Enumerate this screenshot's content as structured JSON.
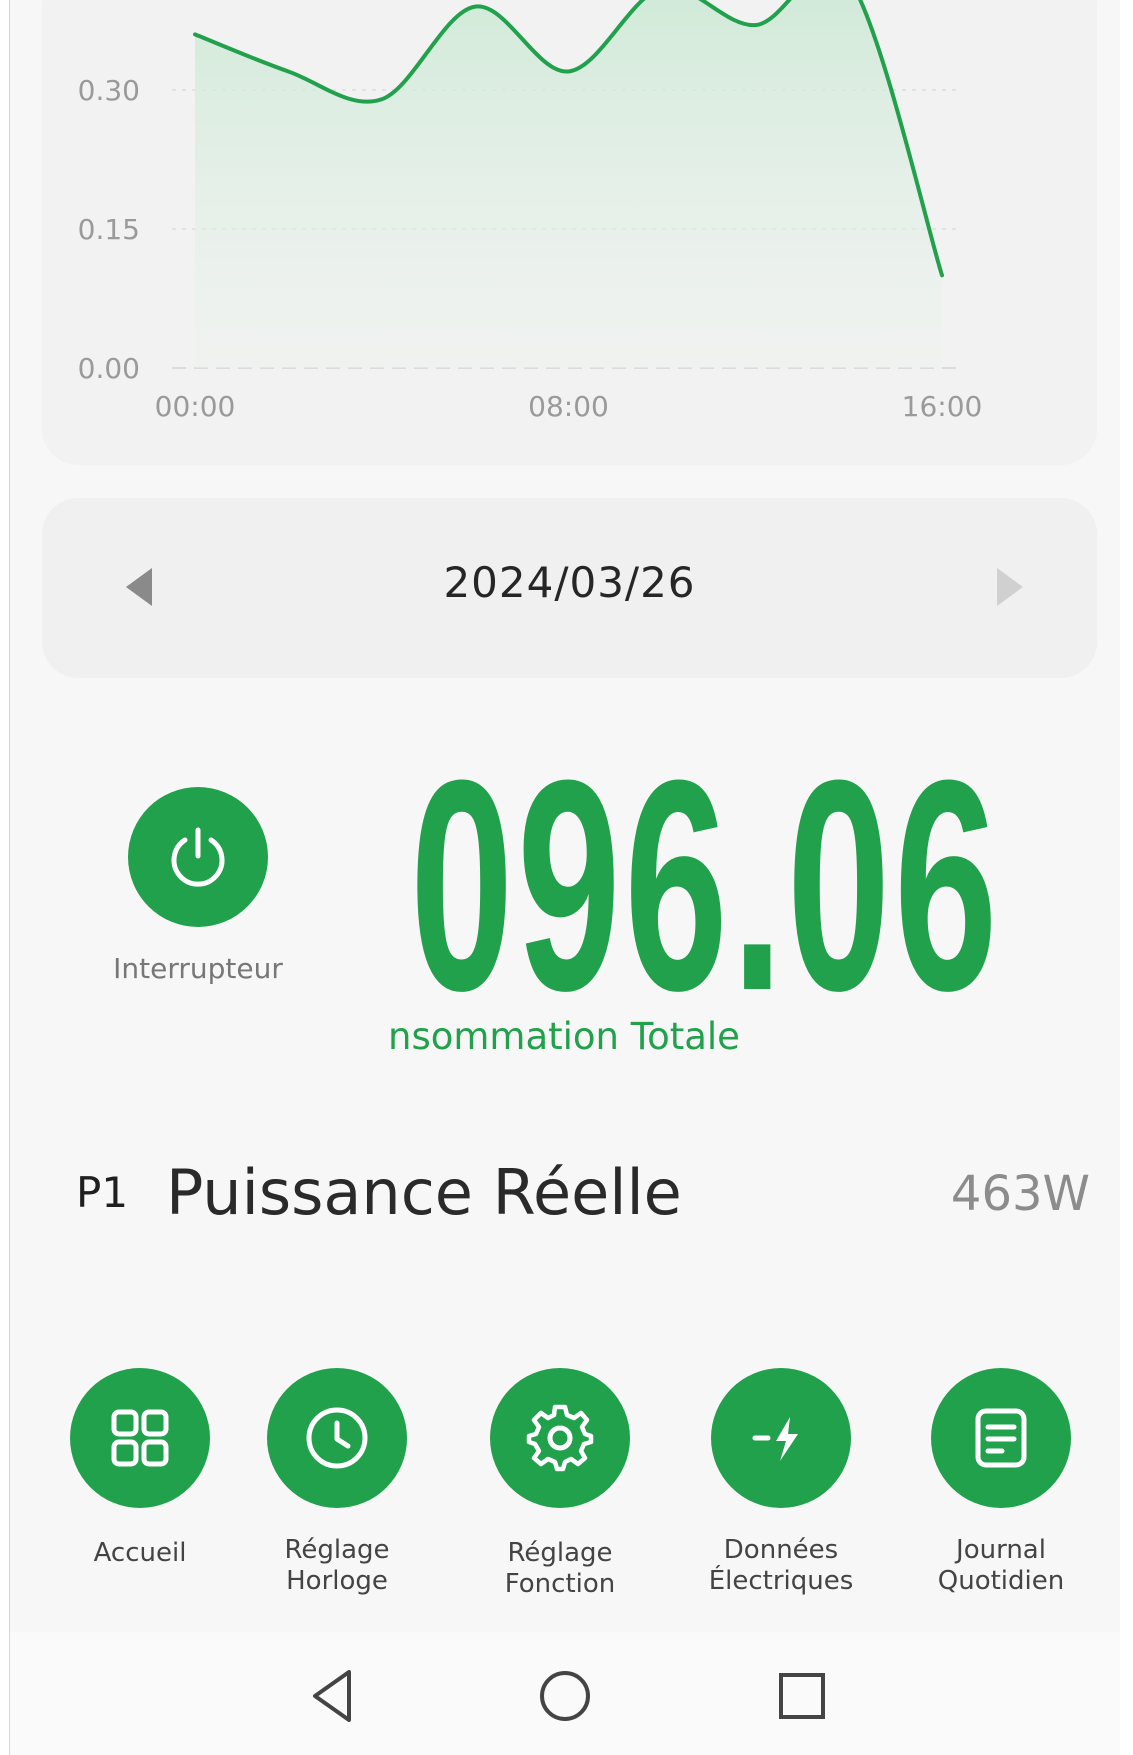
{
  "chart": {
    "y_ticks": [
      "0.30",
      "0.15",
      "0.00"
    ],
    "x_ticks": [
      "00:00",
      "08:00",
      "16:00"
    ]
  },
  "chart_data": {
    "type": "area",
    "x": [
      "00:00",
      "02:00",
      "04:00",
      "06:00",
      "08:00",
      "10:00",
      "12:00",
      "14:00",
      "16:00"
    ],
    "y_ticks": [
      "0.30",
      "0.15",
      "0.00"
    ],
    "x_ticks": [
      "00:00",
      "08:00",
      "16:00"
    ],
    "ylim": [
      0,
      0.3
    ],
    "grid": true,
    "series": [
      {
        "values": [
          0.36,
          0.32,
          0.29,
          0.39,
          0.32,
          0.41,
          0.37,
          0.42,
          0.1
        ]
      }
    ]
  },
  "date": {
    "value": "2024/03/26",
    "prev_icon": "triangle-left-icon",
    "next_icon": "triangle-right-icon"
  },
  "power_switch": {
    "label": "Interrupteur",
    "icon": "power-icon"
  },
  "consumption": {
    "value": "096.06",
    "label": "nsommation Totale"
  },
  "real_power": {
    "phase": "P1",
    "label": "Puissance Réelle",
    "value": "463W"
  },
  "nav": [
    {
      "label": "Accueil",
      "icon": "grid-icon"
    },
    {
      "label": "Réglage\nHorloge",
      "icon": "clock-icon"
    },
    {
      "label": "Réglage\nFonction",
      "icon": "gear-icon"
    },
    {
      "label": "Données\nÉlectriques",
      "icon": "lightning-icon"
    },
    {
      "label": "Journal\nQuotidien",
      "icon": "document-icon"
    }
  ],
  "colors": {
    "accent": "#21a14b",
    "background": "#f7f7f7"
  }
}
